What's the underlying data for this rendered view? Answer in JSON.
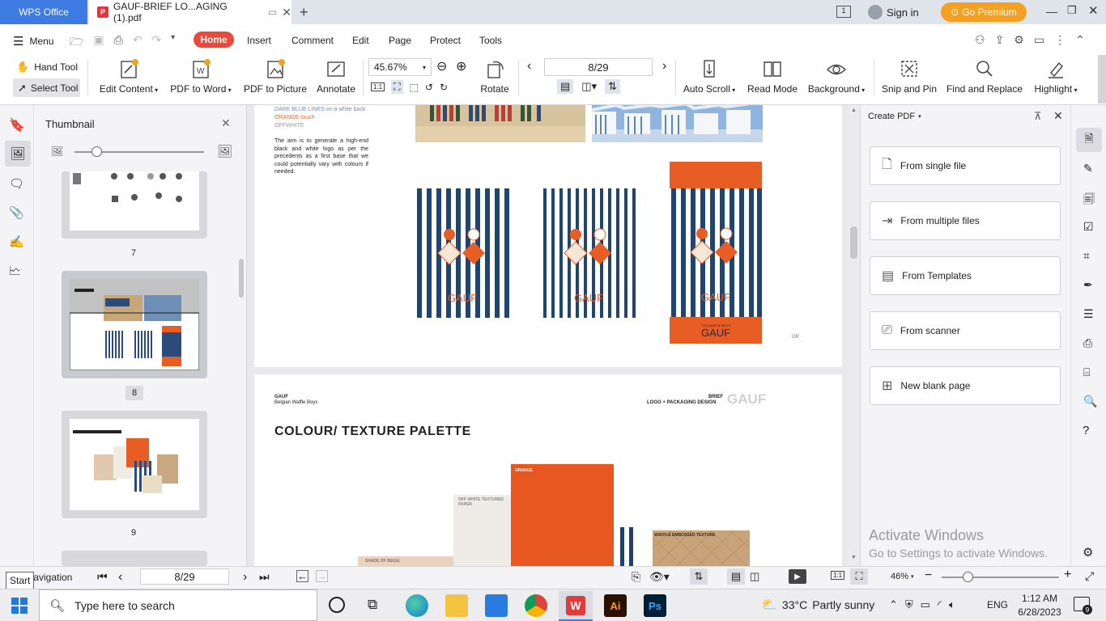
{
  "titlebar": {
    "app_tab": "WPS Office",
    "doc_tab": "GAUF-BRIEF LO...AGING (1).pdf",
    "sign_in": "Sign in",
    "premium": "Go Premium"
  },
  "menu": {
    "menu_label": "Menu",
    "tabs": [
      "Home",
      "Insert",
      "Comment",
      "Edit",
      "Page",
      "Protect",
      "Tools"
    ]
  },
  "ribbon": {
    "hand_tool": "Hand Tool",
    "select_tool": "Select Tool",
    "edit_content": "Edit Content",
    "pdf_to_word": "PDF to Word",
    "pdf_to_picture": "PDF to Picture",
    "annotate": "Annotate",
    "zoom": "45.67%",
    "rotate": "Rotate",
    "page_field": "8/29",
    "auto_scroll": "Auto Scroll",
    "read_mode": "Read Mode",
    "background": "Background",
    "snip_and_pin": "Snip and Pin",
    "find_and_replace": "Find and Replace",
    "highlight": "Highlight"
  },
  "thumbnail": {
    "title": "Thumbnail",
    "pages": [
      "7",
      "8",
      "9"
    ]
  },
  "document": {
    "page8": {
      "colors_line1": "DARK BLUE LINES on a white back",
      "colors_line2": "ORANGE touch",
      "colors_line3": "OFFWHITE",
      "aim_text": "The aim is to generate a high-end black and white logo as per the precedents as a first base that we could potentially vary with colours if needed.",
      "logo_text": "GAUF",
      "logo_sub": "THE WAFFLE BOYS",
      "or_text": "OR"
    },
    "page9": {
      "brand": "GAUF",
      "brand_sub": "Belgian Waffle Boys",
      "brief": "BRIEF",
      "brief_sub": "LOGO + PACKAGING DESIGN",
      "brief_logo": "GAUF",
      "heading": "COLOUR/ TEXTURE PALETTE",
      "swatch_orange": "ORANGE",
      "swatch_offwhite": "OFF WHITE TEXTURED PAPER",
      "swatch_waffle": "WAFFLE EMBOSSED TEXTURE",
      "swatch_beige": "SHADE OF BEIGE"
    }
  },
  "right_panel": {
    "title": "Create PDF",
    "items": [
      "From single file",
      "From multiple files",
      "From Templates",
      "From scanner",
      "New blank page"
    ]
  },
  "watermark": {
    "line1": "Activate Windows",
    "line2": "Go to Settings to activate Windows."
  },
  "statusbar": {
    "navigation": "Navigation",
    "start_tooltip": "Start",
    "page": "8/29",
    "zoom": "46%"
  },
  "taskbar": {
    "search_placeholder": "Type here to search",
    "temperature": "33°C",
    "weather": "Partly sunny",
    "language": "ENG",
    "time": "1:12 AM",
    "date": "6/28/2023",
    "notifications": "9"
  }
}
